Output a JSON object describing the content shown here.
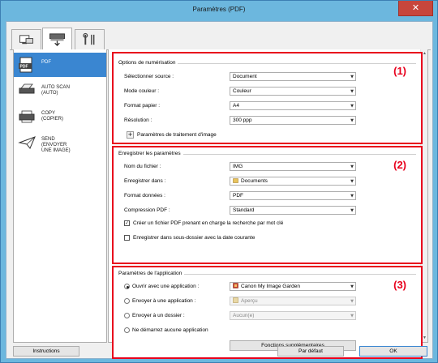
{
  "window": {
    "title": "Paramètres (PDF)",
    "close_glyph": "✕"
  },
  "tabs": [
    {
      "name": "scan-from-computer-tab",
      "active": false
    },
    {
      "name": "scan-from-panel-tab",
      "active": true
    },
    {
      "name": "general-settings-tab",
      "active": false
    }
  ],
  "nav": [
    {
      "label": "PDF",
      "icon": "pdf-icon",
      "selected": true
    },
    {
      "label": "AUTO SCAN (AUTO)",
      "icon": "auto-scan-icon",
      "selected": false
    },
    {
      "label": "COPY (COPIER)",
      "icon": "copy-icon",
      "selected": false
    },
    {
      "label": "SEND (ENVOYER UNE IMAGE)",
      "icon": "send-icon",
      "selected": false
    }
  ],
  "scan_options": {
    "title": "Options de numérisation",
    "badge": "(1)",
    "source_label": "Sélectionner source :",
    "source_value": "Document",
    "color_label": "Mode couleur :",
    "color_value": "Couleur",
    "paper_label": "Format papier :",
    "paper_value": "A4",
    "resolution_label": "Résolution :",
    "resolution_value": "300 ppp",
    "image_processing_label": "Paramètres de traitement d'image",
    "expand_glyph": "+"
  },
  "save_settings": {
    "title": "Enregistrer les paramètres",
    "badge": "(2)",
    "filename_label": "Nom du fichier :",
    "filename_value": "IMG",
    "save_in_label": "Enregistrer dans :",
    "save_in_value": "Documents",
    "format_label": "Format données :",
    "format_value": "PDF",
    "compression_label": "Compression PDF :",
    "compression_value": "Standard",
    "searchable_label": "Créer un fichier PDF prenant en charge la recherche par mot clé",
    "searchable_checked": true,
    "subfolder_label": "Enregistrer dans sous-dossier avec la date courante",
    "subfolder_checked": false,
    "check_glyph": "✓"
  },
  "app_settings": {
    "title": "Paramètres de l'application",
    "badge": "(3)",
    "open_app_label": "Ouvrir avec une application :",
    "open_app_value": "Canon My Image Garden",
    "send_app_label": "Envoyer à une application :",
    "send_app_value": "Aperçu",
    "send_folder_label": "Envoyer à un dossier :",
    "send_folder_value": "Aucun(e)",
    "no_app_label": "Ne démarrez aucune application",
    "selected_option": "open_app",
    "more_functions_label": "Fonctions supplémentaires"
  },
  "footer": {
    "instructions_label": "Instructions",
    "defaults_label": "Par défaut",
    "ok_label": "OK"
  },
  "colors": {
    "highlight_red": "#e8001c",
    "selection_blue": "#3a86d1",
    "window_frame": "#6cb7de"
  }
}
